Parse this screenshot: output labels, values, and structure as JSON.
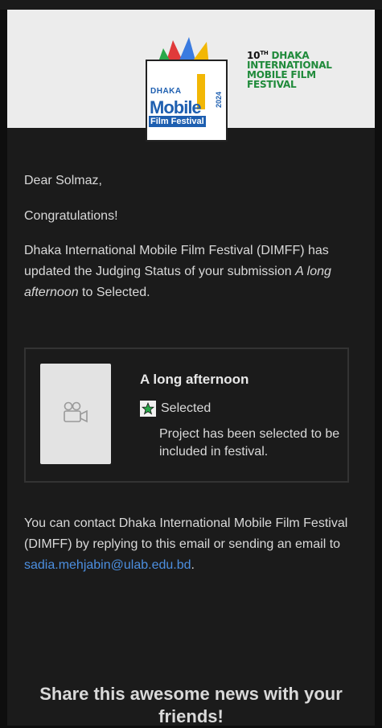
{
  "banner": {
    "festival_line1": "DHAKA",
    "festival_ordinal": "10",
    "festival_ordinal_sup": "TH",
    "festival_line2": "INTERNATIONAL",
    "festival_line3": "MOBILE FILM",
    "festival_line4": "FESTIVAL",
    "logo_top": "DHAKA",
    "logo_mid": "Mobile",
    "logo_bottom": "Film Festival",
    "logo_year": "2024"
  },
  "email": {
    "greeting": "Dear Solmaz,",
    "congrats": "Congratulations!",
    "body_prefix": "Dhaka International Mobile Film Festival (DIMFF) has updated the Judging Status of your submission ",
    "body_project": "A long afternoon",
    "body_suffix": " to Selected.",
    "contact_text": "You can contact Dhaka International Mobile Film Festival (DIMFF) by replying to this email or sending an email to ",
    "contact_email": "sadia.mehjabin@ulab.edu.bd",
    "contact_end": ".",
    "share_heading": "Share this awesome news with your friends!"
  },
  "project_card": {
    "title": "A long afternoon",
    "status": "Selected",
    "status_description": "Project has been selected to be included in festival.",
    "thumbnail_icon": "video-camera-icon",
    "status_icon": "star-icon"
  }
}
